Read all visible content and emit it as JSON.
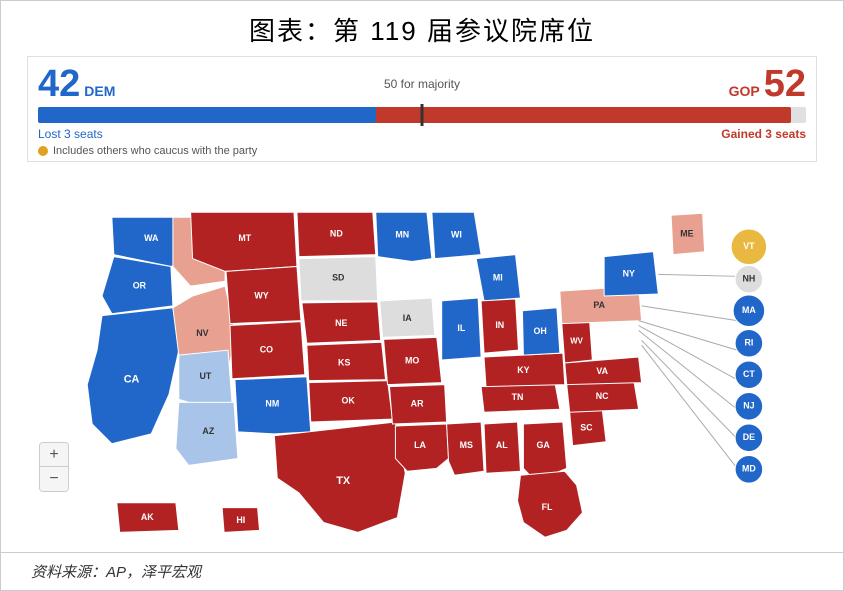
{
  "title": "图表：第 119 届参议院席位",
  "dem": {
    "number": "42",
    "label": "DEM"
  },
  "gop": {
    "number": "52",
    "label": "GOP"
  },
  "majority_label": "50 for majority",
  "dem_bar_pct": 42,
  "gop_bar_pct": 52,
  "lost_seats": "Lost 3 seats",
  "gained_seats": "Gained 3 seats",
  "includes_note": "Includes others who caucus with the party",
  "source": "资料来源：AP，泽平宏观",
  "zoom_plus": "+",
  "zoom_minus": "−",
  "colors": {
    "dem_blue": "#2166c9",
    "gop_red": "#b22222",
    "light_blue": "#a8c4e8",
    "light_red": "#e8a090",
    "gold": "#e8b840",
    "neutral": "#ddd"
  }
}
